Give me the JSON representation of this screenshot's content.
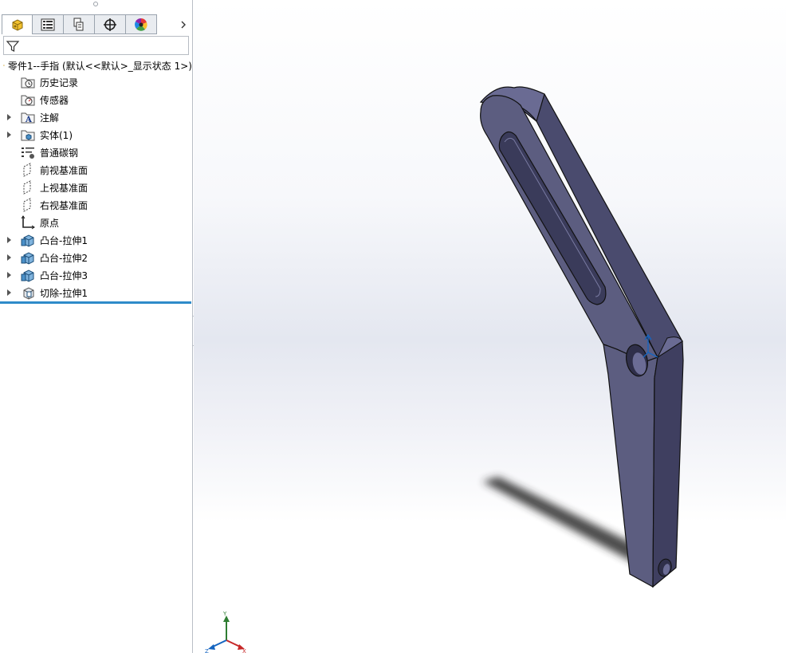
{
  "colors": {
    "part_face": "#5c5d80",
    "part_side": "#3f3f60",
    "part_top": "#6a6b93",
    "accent_line": "#2e8bc9"
  },
  "tabs": [
    {
      "name": "feature-manager",
      "icon": "part-icon"
    },
    {
      "name": "property-manager",
      "icon": "property-list-icon"
    },
    {
      "name": "configuration-manager",
      "icon": "configuration-icon"
    },
    {
      "name": "dimxpert-manager",
      "icon": "crosshair-icon"
    },
    {
      "name": "display-manager",
      "icon": "color-wheel-icon"
    }
  ],
  "tree": {
    "root_label": "零件1--手指  (默认<<默认>_显示状态 1>)",
    "items": [
      {
        "label": "历史记录",
        "icon": "history-folder-icon",
        "expandable": false
      },
      {
        "label": "传感器",
        "icon": "sensor-folder-icon",
        "expandable": false
      },
      {
        "label": "注解",
        "icon": "annotation-folder-icon",
        "expandable": true
      },
      {
        "label": "实体(1)",
        "icon": "solid-bodies-folder-icon",
        "expandable": true
      },
      {
        "label": "普通碳钢",
        "icon": "material-icon",
        "expandable": false
      },
      {
        "label": "前视基准面",
        "icon": "plane-icon",
        "expandable": false
      },
      {
        "label": "上视基准面",
        "icon": "plane-icon",
        "expandable": false
      },
      {
        "label": "右视基准面",
        "icon": "plane-icon",
        "expandable": false
      },
      {
        "label": "原点",
        "icon": "origin-icon",
        "expandable": false
      },
      {
        "label": "凸台-拉伸1",
        "icon": "boss-extrude-icon",
        "expandable": true
      },
      {
        "label": "凸台-拉伸2",
        "icon": "boss-extrude-icon",
        "expandable": true
      },
      {
        "label": "凸台-拉伸3",
        "icon": "boss-extrude-icon",
        "expandable": true
      },
      {
        "label": "切除-拉伸1",
        "icon": "cut-extrude-icon",
        "expandable": true
      }
    ]
  },
  "triad": {
    "x_label": "X",
    "y_label": "Y",
    "z_label": "Z"
  }
}
